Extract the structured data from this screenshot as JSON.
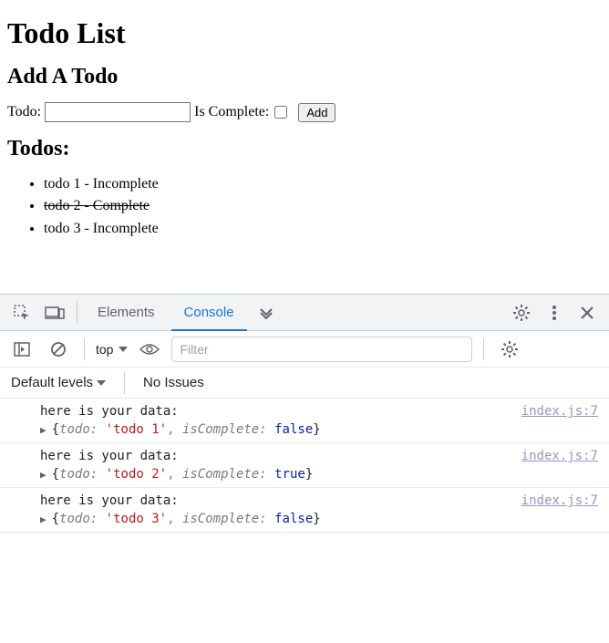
{
  "page": {
    "title": "Todo List",
    "form_heading": "Add A Todo",
    "todo_label": "Todo:",
    "is_complete_label": "Is Complete:",
    "add_button": "Add",
    "todos_heading": "Todos:"
  },
  "todos": [
    {
      "label": "todo 1 - Incomplete",
      "completed": false
    },
    {
      "label": "todo 2 - Complete",
      "completed": true
    },
    {
      "label": "todo 3 - Incomplete",
      "completed": false
    }
  ],
  "devtools": {
    "tabs": {
      "elements": "Elements",
      "console": "Console"
    },
    "console_bar": {
      "context": "top",
      "filter_placeholder": "Filter"
    },
    "levels_bar": {
      "levels": "Default levels",
      "issues": "No Issues"
    },
    "log_prefix": "here is your data:",
    "source": "index.js:7",
    "entries": [
      {
        "todo": "'todo 1'",
        "isComplete": "false"
      },
      {
        "todo": "'todo 2'",
        "isComplete": "true"
      },
      {
        "todo": "'todo 3'",
        "isComplete": "false"
      }
    ]
  }
}
